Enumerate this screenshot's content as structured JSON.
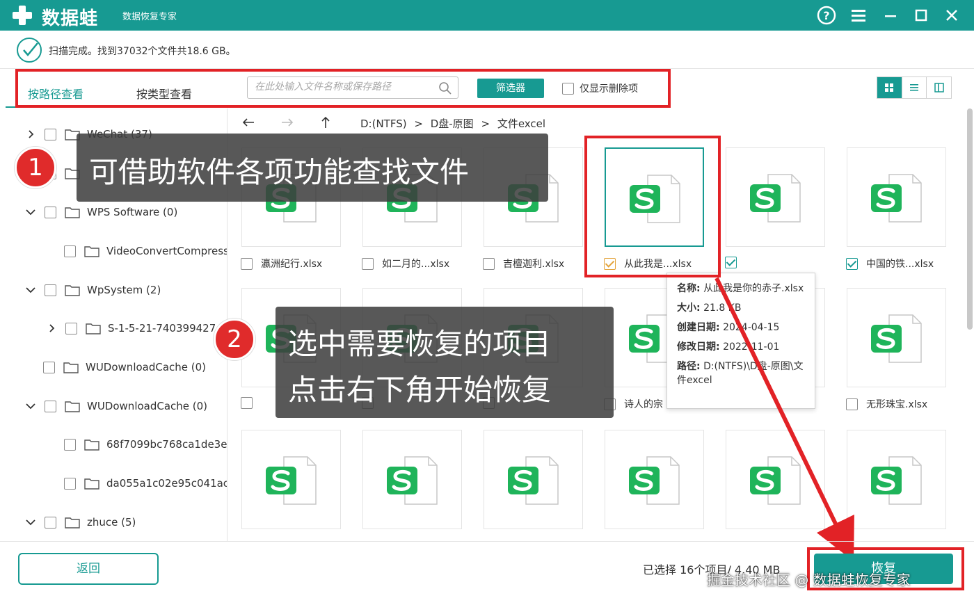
{
  "titlebar": {
    "app_name": "数据蛙",
    "app_sub": "数据恢复专家",
    "icons": [
      "help-icon",
      "menu-icon",
      "minimize-icon",
      "maximize-icon",
      "close-icon"
    ]
  },
  "status": {
    "text": "扫描完成。找到37032个文件共18.6 GB。"
  },
  "tabs": {
    "by_path": "按路径查看",
    "by_type": "按类型查看"
  },
  "search": {
    "placeholder": "在此处输入文件名称或保存路径"
  },
  "filter_label": "筛选器",
  "only_deleted_label": "仅显示删除项",
  "breadcrumb": [
    "D:(NTFS)",
    "D盘-原图",
    "文件excel"
  ],
  "breadcrumb_sep": ">",
  "sidebar": {
    "items": [
      {
        "label": "WeChat (37)",
        "chev": "right"
      },
      {
        "label": "",
        "chev": "none"
      },
      {
        "label": "WPS Software (0)",
        "chev": "down"
      },
      {
        "label": "VideoConvertCompress",
        "chev": "none"
      },
      {
        "label": "WpSystem (2)",
        "chev": "down"
      },
      {
        "label": "S-1-5-21-740399427",
        "chev": "right"
      },
      {
        "label": "WUDownloadCache (0)",
        "chev": "none"
      },
      {
        "label": "WUDownloadCache (0)",
        "chev": "down"
      },
      {
        "label": "68f7099bc768ca1de3e",
        "chev": "none"
      },
      {
        "label": "da055a1c02e95c041ac",
        "chev": "none"
      },
      {
        "label": "zhuce (5)",
        "chev": "down"
      }
    ]
  },
  "files": [
    {
      "name": "",
      "checked": false
    },
    {
      "name": "",
      "checked": false
    },
    {
      "name": "",
      "checked": false
    },
    {
      "name": "从此我是...xlsx",
      "checked": true
    },
    {
      "name": "",
      "checked": true
    },
    {
      "name": "中国的铁...xlsx",
      "checked": true
    },
    {
      "name": "瀛洲纪行.xlsx",
      "checked": false
    },
    {
      "name": "如二月的...xlsx",
      "checked": false
    },
    {
      "name": "吉檀迦利.xlsx",
      "checked": false
    },
    {
      "name": "",
      "checked": false
    },
    {
      "name": "",
      "checked": false
    },
    {
      "name": "无形珠宝.xlsx",
      "checked": false
    }
  ],
  "row1_labels": [
    "瀛洲纪行.xlsx",
    "如二月的...xlsx",
    "吉檀迦利.xlsx",
    "从此我是...xlsx",
    "",
    "中国的铁...xlsx"
  ],
  "row2_labels": [
    "",
    "",
    "",
    "诗人的宗",
    "",
    "无形珠宝.xlsx"
  ],
  "tooltip": {
    "name_k": "名称:",
    "name_v": "从此我是你的赤子.xlsx",
    "size_k": "大小:",
    "size_v": "21.8 KB",
    "created_k": "创建日期:",
    "created_v": "2024-04-15",
    "modified_k": "修改日期:",
    "modified_v": "2022-11-01",
    "path_k": "路径:",
    "path_v": "D:(NTFS)\\D盘-原图\\文件excel"
  },
  "overlay": {
    "step1_num": "1",
    "step1_text": "可借助软件各项功能查找文件",
    "step2_num": "2",
    "step2_line1": "选中需要恢复的项目",
    "step2_line2": "点击右下角开始恢复"
  },
  "bottom": {
    "back_label": "返回",
    "selection_info": "已选择 16个项目/ 4.40 MB",
    "recover_label": "恢复"
  },
  "watermark": "掘金技术社区 @ 数据蛙恢复专家",
  "colors": {
    "accent": "#179a92",
    "highlight": "#e22226",
    "excel_green": "#1fb45a"
  }
}
